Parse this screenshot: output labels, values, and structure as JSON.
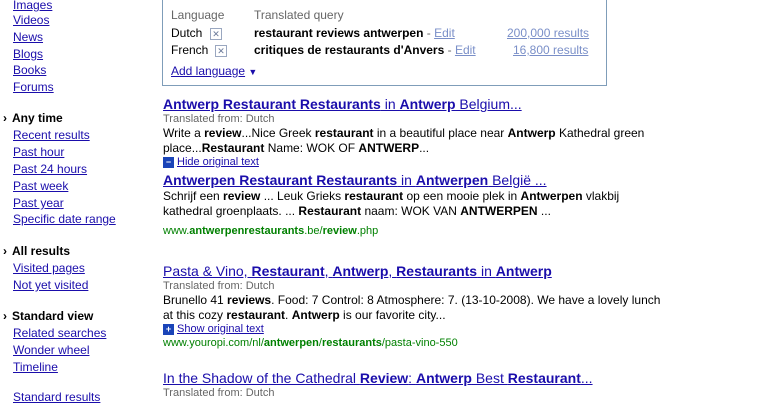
{
  "sidebar": {
    "type_links": [
      "Images",
      "Videos",
      "News",
      "Blogs",
      "Books",
      "Forums"
    ],
    "time_head": "Any time",
    "time_links": [
      "Recent results",
      "Past hour",
      "Past 24 hours",
      "Past week",
      "Past year",
      "Specific date range"
    ],
    "results_head": "All results",
    "results_links": [
      "Visited pages",
      "Not yet visited"
    ],
    "view_head": "Standard view",
    "view_links": [
      "Related searches",
      "Wonder wheel",
      "Timeline"
    ],
    "bottom_link": "Standard results"
  },
  "translation_box": {
    "col_language": "Language",
    "col_query": "Translated query",
    "rows": [
      {
        "language": "Dutch",
        "query": "restaurant reviews antwerpen",
        "edit": "Edit",
        "results": "200,000 results"
      },
      {
        "language": "French",
        "query": "critiques de restaurants d'Anvers",
        "edit": "Edit",
        "results": "16,800 results"
      }
    ],
    "add_language": "Add language"
  },
  "results": [
    {
      "title_parts": [
        "Antwerp Restaurant Restaurants",
        " in ",
        "Antwerp",
        " Belgium..."
      ],
      "translated_from": "Translated from: Dutch",
      "snippet_line1": [
        "Write a ",
        "review",
        "...Nice Greek ",
        "restaurant",
        " in a beautiful place near ",
        "Antwerp",
        " Kathedral green"
      ],
      "snippet_line2": [
        "place...",
        "Restaurant",
        " Name: WOK OF ",
        "ANTWERP",
        "..."
      ],
      "toggle": "Hide original text",
      "orig_title_parts": [
        "Antwerpen Restaurant Restaurants",
        " in ",
        "Antwerpen",
        " België ..."
      ],
      "orig_line1": [
        "Schrijf een ",
        "review",
        " ... Leuk Grieks ",
        "restaurant",
        " op een mooie plek in ",
        "Antwerpen",
        " vlakbij"
      ],
      "orig_line2": [
        "kathedral groenplaats. ... ",
        "Restaurant",
        " naam: WOK VAN ",
        "ANTWERPEN",
        " ..."
      ],
      "url_parts": [
        "www.",
        "antwerpenrestaurants",
        ".be/",
        "review",
        ".php"
      ]
    },
    {
      "title_parts": [
        "Pasta & Vino, ",
        "Restaurant",
        ", ",
        "Antwerp",
        ", ",
        "Restaurants",
        " in ",
        "Antwerp"
      ],
      "translated_from": "Translated from: Dutch",
      "snippet_line1": [
        "Brunello 41 ",
        "reviews",
        ". Food: 7 Control: 8 Atmosphere: 7. (13-10-2008). We have a lovely lunch"
      ],
      "snippet_line2": [
        "at this cozy ",
        "restaurant",
        ". ",
        "Antwerp",
        " is our favorite city..."
      ],
      "toggle": "Show original text",
      "url_parts": [
        "www.youropi.com/nl/",
        "antwerpen",
        "/",
        "restaurants",
        "/pasta-vino-550"
      ]
    },
    {
      "title_parts": [
        "In the Shadow of the Cathedral ",
        "Review",
        ": ",
        "Antwerp",
        " Best ",
        "Restaurant",
        "..."
      ],
      "translated_from": "Translated from: Dutch"
    }
  ]
}
